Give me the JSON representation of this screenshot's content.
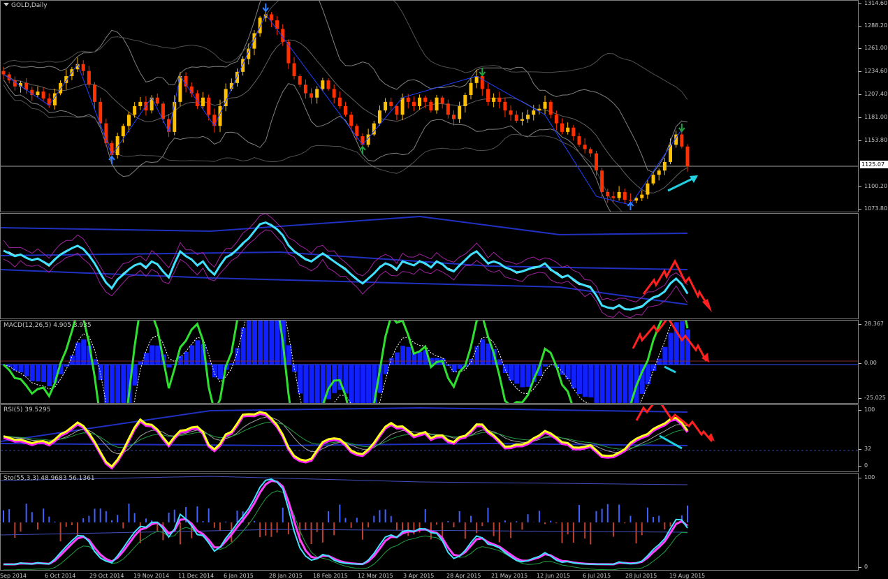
{
  "symbol_label": "GOLD,Daily",
  "current_price": "1125.07",
  "price_scale": [
    "1314.60",
    "1288.20",
    "1261.00",
    "1234.60",
    "1207.40",
    "1181.00",
    "1153.80",
    "1125.07",
    "1100.20",
    "1073.80"
  ],
  "indicators": {
    "macd": {
      "label": "MACD(12,26,5) 4.905 3.935",
      "scale": [
        "28.367",
        "0.00",
        "-25.025"
      ]
    },
    "rsi": {
      "label": "RSI(5) 39.5295",
      "scale": [
        "100",
        "32",
        "0"
      ]
    },
    "stoch": {
      "label": "Sto(55,3,3) 48.9683 56.1361",
      "scale": [
        "100",
        "0"
      ]
    }
  },
  "time_axis": [
    "Sep 2014",
    "6 Oct 2014",
    "29 Oct 2014",
    "19 Nov 2014",
    "11 Dec 2014",
    "6 Jan 2015",
    "28 Jan 2015",
    "18 Feb 2015",
    "12 Mar 2015",
    "3 Apr 2015",
    "28 Apr 2015",
    "21 May 2015",
    "12 Jun 2015",
    "6 Jul 2015",
    "28 Jul 2015",
    "19 Aug 2015"
  ],
  "colors": {
    "background": "#000000",
    "bull_candle": "#ffc000",
    "bear_candle": "#ff3000",
    "zigzag": "#2040ff",
    "bollinger": "#808080",
    "osc_main": "#40e0ff",
    "macd_main": "#30e030",
    "macd_hist": "#1020ff",
    "rsi_main": "#ffff20",
    "stoch_main": "#40e0ff",
    "annotation_red": "#ff2020",
    "annotation_cyan": "#20d0e0"
  },
  "chart_data": {
    "type": "candlestick",
    "series": [
      {
        "name": "GOLD,Daily",
        "values": [
          1232,
          1225,
          1218,
          1222,
          1214,
          1208,
          1212,
          1204,
          1196,
          1210,
          1222,
          1230,
          1238,
          1244,
          1236,
          1220,
          1200,
          1175,
          1152,
          1138,
          1160,
          1172,
          1185,
          1195,
          1200,
          1190,
          1205,
          1198,
          1180,
          1165,
          1200,
          1230,
          1218,
          1210,
          1195,
          1205,
          1185,
          1172,
          1195,
          1215,
          1222,
          1235,
          1250,
          1262,
          1280,
          1298,
          1302,
          1295,
          1285,
          1270,
          1245,
          1230,
          1220,
          1210,
          1205,
          1215,
          1225,
          1215,
          1205,
          1195,
          1185,
          1172,
          1160,
          1150,
          1162,
          1175,
          1190,
          1200,
          1195,
          1185,
          1205,
          1200,
          1195,
          1205,
          1200,
          1190,
          1205,
          1198,
          1185,
          1180,
          1195,
          1208,
          1222,
          1230,
          1215,
          1200,
          1205,
          1200,
          1190,
          1185,
          1178,
          1180,
          1185,
          1190,
          1192,
          1200,
          1185,
          1175,
          1165,
          1170,
          1160,
          1150,
          1145,
          1140,
          1120,
          1095,
          1090,
          1088,
          1095,
          1086,
          1085,
          1088,
          1092,
          1105,
          1115,
          1120,
          1130,
          1150,
          1162,
          1148,
          1125
        ]
      }
    ],
    "ylim": [
      1073.8,
      1314.6
    ],
    "xlabel": "",
    "ylabel": ""
  }
}
